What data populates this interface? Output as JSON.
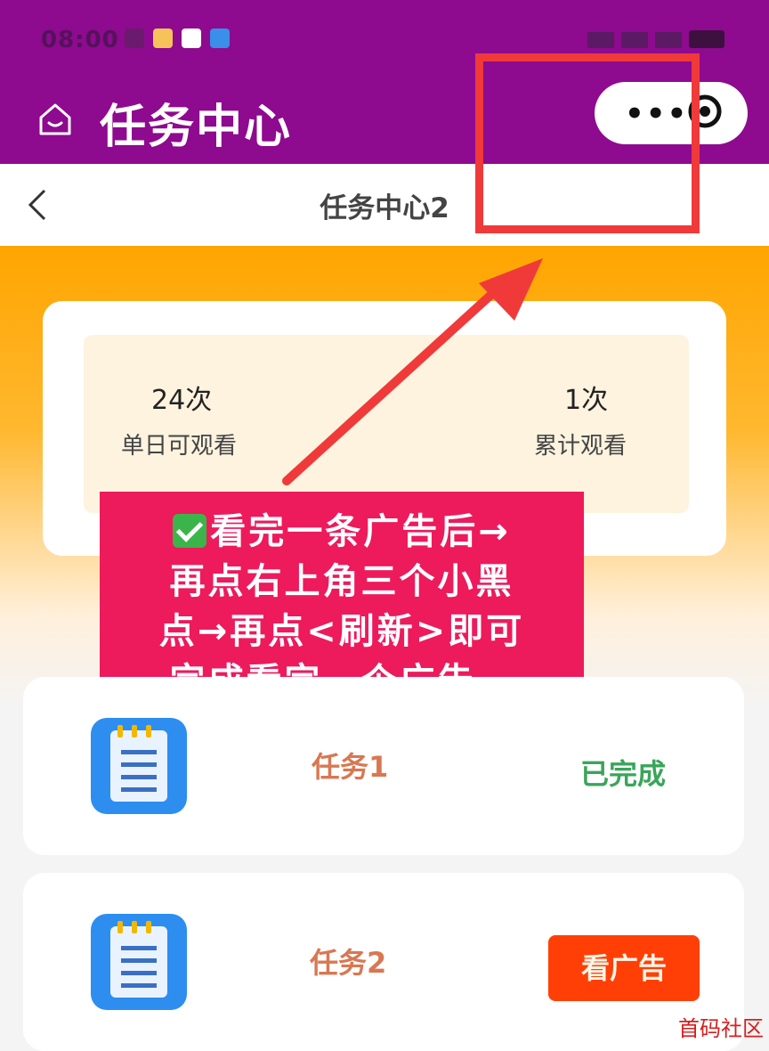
{
  "status_bar": {
    "time": "08:00"
  },
  "app_bar": {
    "title": "任务中心",
    "menu_label": "•••"
  },
  "nav_bar": {
    "title": "任务中心2"
  },
  "stats": {
    "daily": {
      "value": "24次",
      "label": "单日可观看"
    },
    "total": {
      "value": "1次",
      "label": "累计观看"
    }
  },
  "annotation": {
    "lines": [
      "看完一条广告后→",
      "再点右上角三个小黑",
      "点→再点<刷新>即可",
      "完成看完一个广告。"
    ]
  },
  "tasks": [
    {
      "name": "任务1",
      "status": "已完成"
    },
    {
      "name": "任务2",
      "button": "看广告"
    }
  ],
  "watermark": "首码社区",
  "colors": {
    "header": "#8e0a8f",
    "accent_orange": "#ffa500",
    "annotation_red": "#f03a3a",
    "banner_pink": "#ed1a5c",
    "done_green": "#3aa55a",
    "ad_button": "#ff3f06"
  }
}
